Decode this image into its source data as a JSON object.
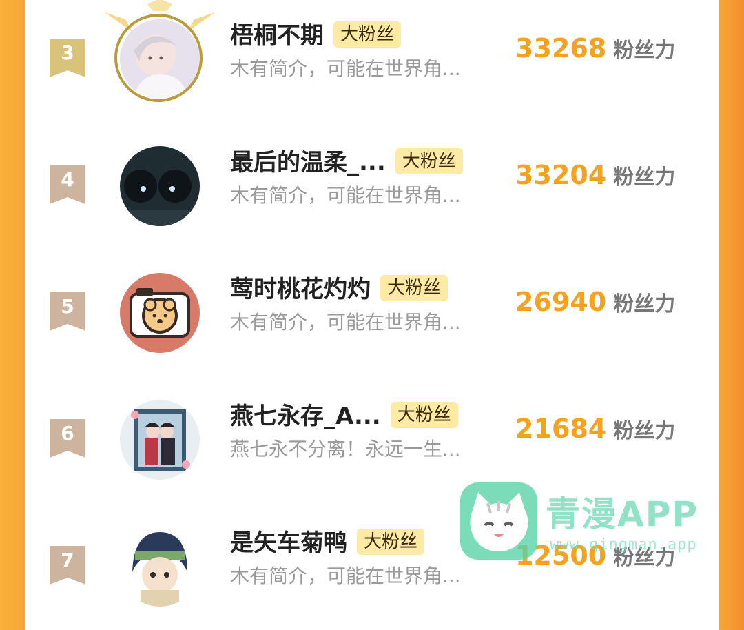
{
  "ranking": [
    {
      "rank": "3",
      "name": "梧桐不期",
      "badge": "大粉丝",
      "bio": "木有简介，可能在世界角...",
      "score": "33268",
      "unit": "粉丝力"
    },
    {
      "rank": "4",
      "name": "最后的温柔_...",
      "badge": "大粉丝",
      "bio": "木有简介，可能在世界角...",
      "score": "33204",
      "unit": "粉丝力"
    },
    {
      "rank": "5",
      "name": "莺时桃花灼灼",
      "badge": "大粉丝",
      "bio": "木有简介，可能在世界角...",
      "score": "26940",
      "unit": "粉丝力"
    },
    {
      "rank": "6",
      "name": "燕七永存_A...",
      "badge": "大粉丝",
      "bio": "燕七永不分离！永远一生...",
      "score": "21684",
      "unit": "粉丝力"
    },
    {
      "rank": "7",
      "name": "是矢车菊鸭",
      "badge": "大粉丝",
      "bio": "木有简介，可能在世界角...",
      "score": "12500",
      "unit": "粉丝力"
    }
  ],
  "watermark": {
    "title": "青漫APP",
    "url": "www.qingman.app"
  },
  "colors": {
    "accent": "#f5a21e",
    "badge_bg": "#fdeaa4",
    "rank_bronze": "#cdb49e",
    "rank_gold": "#d9c27a",
    "side_orange": "#f7a637"
  }
}
